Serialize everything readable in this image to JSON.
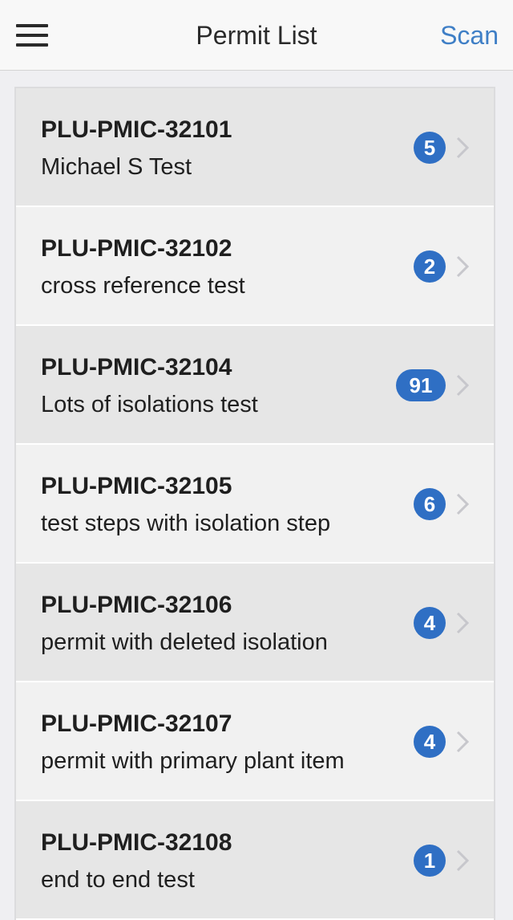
{
  "header": {
    "title": "Permit List",
    "scan_label": "Scan",
    "menu_icon": "hamburger-menu-icon",
    "accent_color": "#3f7fc6"
  },
  "permits": [
    {
      "id": "PLU-PMIC-32101",
      "description": "Michael S Test",
      "count": "5"
    },
    {
      "id": "PLU-PMIC-32102",
      "description": "cross reference test",
      "count": "2"
    },
    {
      "id": "PLU-PMIC-32104",
      "description": "Lots of isolations test",
      "count": "91"
    },
    {
      "id": "PLU-PMIC-32105",
      "description": "test steps with isolation step",
      "count": "6"
    },
    {
      "id": "PLU-PMIC-32106",
      "description": "permit with deleted isolation",
      "count": "4"
    },
    {
      "id": "PLU-PMIC-32107",
      "description": "permit with primary plant item",
      "count": "4"
    },
    {
      "id": "PLU-PMIC-32108",
      "description": "end to end test",
      "count": "1"
    }
  ],
  "badge_color": "#2f6fc4"
}
